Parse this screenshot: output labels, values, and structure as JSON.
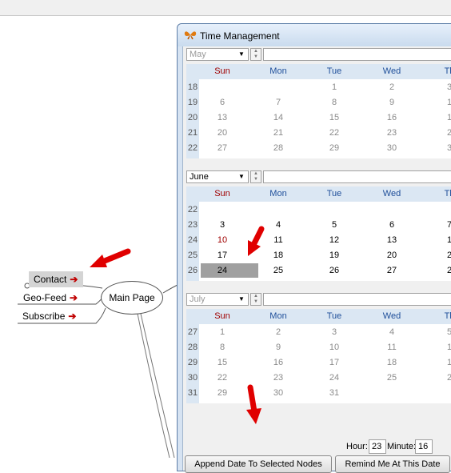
{
  "window": {
    "title": "Time Management",
    "weekday_headers": [
      "Sun",
      "Mon",
      "Tue",
      "Wed",
      "Th"
    ]
  },
  "mindmap": {
    "nodes": [
      {
        "label": "Contact",
        "arrow": "➔"
      },
      {
        "label": "Geo-Feed",
        "arrow": "➔"
      },
      {
        "label": "Subscribe",
        "arrow": "➔"
      }
    ],
    "main_node": "Main Page"
  },
  "calendars": [
    {
      "month": "May",
      "enabled": false,
      "weeks": [
        {
          "wk": "18",
          "days": [
            "",
            "",
            "1",
            "2",
            "3"
          ]
        },
        {
          "wk": "19",
          "days": [
            "6",
            "7",
            "8",
            "9",
            "1"
          ]
        },
        {
          "wk": "20",
          "days": [
            "13",
            "14",
            "15",
            "16",
            "1"
          ]
        },
        {
          "wk": "21",
          "days": [
            "20",
            "21",
            "22",
            "23",
            "2"
          ]
        },
        {
          "wk": "22",
          "days": [
            "27",
            "28",
            "29",
            "30",
            "3"
          ]
        }
      ]
    },
    {
      "month": "June",
      "enabled": true,
      "weeks": [
        {
          "wk": "22",
          "days": [
            "",
            "",
            "",
            "",
            ""
          ]
        },
        {
          "wk": "23",
          "days": [
            "3",
            "4",
            "5",
            "6",
            "7"
          ]
        },
        {
          "wk": "24",
          "days": [
            "10",
            "11",
            "12",
            "13",
            "1"
          ]
        },
        {
          "wk": "25",
          "days": [
            "17",
            "18",
            "19",
            "20",
            "2"
          ]
        },
        {
          "wk": "26",
          "days": [
            "24",
            "25",
            "26",
            "27",
            "2"
          ]
        }
      ],
      "selected_day": "24",
      "highlighted_sunday": "10"
    },
    {
      "month": "July",
      "enabled": false,
      "weeks": [
        {
          "wk": "27",
          "days": [
            "1",
            "2",
            "3",
            "4",
            "5"
          ]
        },
        {
          "wk": "28",
          "days": [
            "8",
            "9",
            "10",
            "11",
            "1"
          ]
        },
        {
          "wk": "29",
          "days": [
            "15",
            "16",
            "17",
            "18",
            "1"
          ]
        },
        {
          "wk": "30",
          "days": [
            "22",
            "23",
            "24",
            "25",
            "2"
          ]
        },
        {
          "wk": "31",
          "days": [
            "29",
            "30",
            "31",
            "",
            ""
          ]
        }
      ]
    }
  ],
  "time": {
    "hour_label": "Hour:",
    "hour_value": "23",
    "minute_label": "Minute:",
    "minute_value": "16"
  },
  "buttons": {
    "append": "Append Date To Selected Nodes",
    "remind": "Remind Me At This Date"
  },
  "colors": {
    "arrow_red": "#e00000",
    "selection_gray": "#a0a0a0",
    "sunday_red": "#a00000",
    "weekday_blue": "#1f4f9a"
  }
}
